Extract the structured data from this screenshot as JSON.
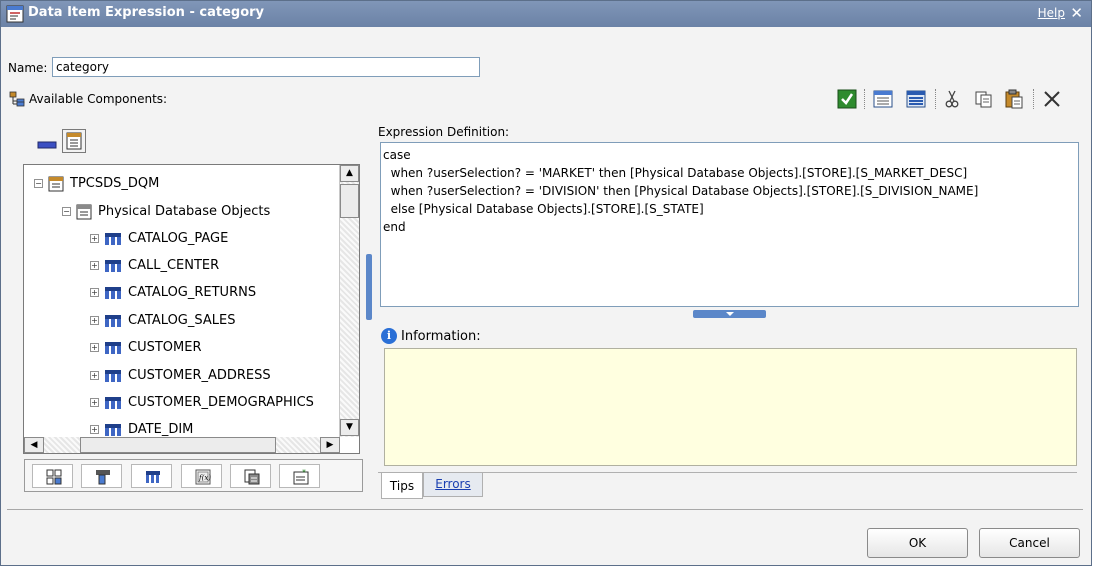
{
  "window": {
    "title": "Data Item Expression - category",
    "help_label": "Help",
    "close_glyph": "✕",
    "title_icon": "data-item-expression-icon"
  },
  "name_field": {
    "label": "Name:",
    "value": "category"
  },
  "available_components": {
    "label": "Available Components:",
    "view_toggle_icons": [
      "collapse-tree-icon",
      "package-view-icon"
    ],
    "tree": [
      {
        "label": "TPCSDS_DQM",
        "level": 0,
        "expander": "−",
        "icon": "package-icon"
      },
      {
        "label": "Physical Database Objects",
        "level": 1,
        "expander": "−",
        "icon": "namespace-icon"
      },
      {
        "label": "CATALOG_PAGE",
        "level": 2,
        "expander": "+",
        "icon": "query-subject-icon"
      },
      {
        "label": "CALL_CENTER",
        "level": 2,
        "expander": "+",
        "icon": "query-subject-icon"
      },
      {
        "label": "CATALOG_RETURNS",
        "level": 2,
        "expander": "+",
        "icon": "query-subject-icon"
      },
      {
        "label": "CATALOG_SALES",
        "level": 2,
        "expander": "+",
        "icon": "query-subject-icon"
      },
      {
        "label": "CUSTOMER",
        "level": 2,
        "expander": "+",
        "icon": "query-subject-icon"
      },
      {
        "label": "CUSTOMER_ADDRESS",
        "level": 2,
        "expander": "+",
        "icon": "query-subject-icon"
      },
      {
        "label": "CUSTOMER_DEMOGRAPHICS",
        "level": 2,
        "expander": "+",
        "icon": "query-subject-icon"
      },
      {
        "label": "DATE_DIM",
        "level": 2,
        "expander": "+",
        "icon": "query-subject-icon"
      }
    ],
    "bottom_tab_icons": [
      "source-tab-icon",
      "data-items-tab-icon",
      "queries-tab-icon",
      "functions-tab-icon",
      "parameters-tab-icon",
      "macros-tab-icon"
    ]
  },
  "toolbar": {
    "icons": [
      "validate-icon",
      "show-selected-icon",
      "show-all-icon",
      "cut-icon",
      "copy-icon",
      "paste-icon",
      "delete-icon"
    ]
  },
  "expression": {
    "label": "Expression Definition:",
    "text": "case\n  when ?userSelection? = 'MARKET' then [Physical Database Objects].[STORE].[S_MARKET_DESC]\n  when ?userSelection? = 'DIVISION' then [Physical Database Objects].[STORE].[S_DIVISION_NAME]\n  else [Physical Database Objects].[STORE].[S_STATE]\nend"
  },
  "information": {
    "label": "Information:",
    "tabs": [
      "Tips",
      "Errors"
    ]
  },
  "buttons": {
    "ok": "OK",
    "cancel": "Cancel"
  },
  "colors": {
    "title_bar": "#6b82a6",
    "info_background": "#ffffe0",
    "splitter": "#5b87c9",
    "validate_green": "#2e8b2e"
  }
}
